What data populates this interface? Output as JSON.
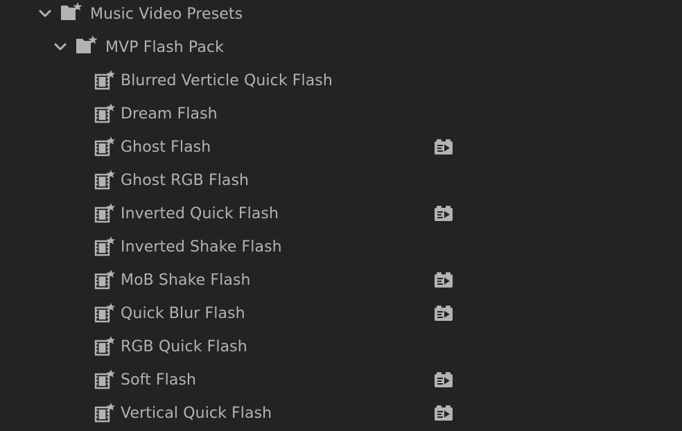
{
  "tree": {
    "root": {
      "label": "Music Video Presets",
      "expanded": true,
      "icon": "preset-bin-icon"
    },
    "group": {
      "label": "MVP Flash Pack",
      "expanded": true,
      "icon": "preset-bin-icon"
    },
    "presets": [
      {
        "label": "Blurred Verticle Quick Flash",
        "icon": "preset-clip-icon",
        "badge": false
      },
      {
        "label": "Dream Flash",
        "icon": "preset-clip-icon",
        "badge": false
      },
      {
        "label": "Ghost Flash",
        "icon": "preset-clip-icon",
        "badge": true
      },
      {
        "label": "Ghost RGB Flash",
        "icon": "preset-clip-icon",
        "badge": false
      },
      {
        "label": "Inverted Quick Flash",
        "icon": "preset-clip-icon",
        "badge": true
      },
      {
        "label": "Inverted Shake Flash",
        "icon": "preset-clip-icon",
        "badge": false
      },
      {
        "label": "MoB Shake Flash",
        "icon": "preset-clip-icon",
        "badge": true
      },
      {
        "label": "Quick Blur Flash",
        "icon": "preset-clip-icon",
        "badge": true
      },
      {
        "label": "RGB Quick Flash",
        "icon": "preset-clip-icon",
        "badge": false
      },
      {
        "label": "Soft Flash",
        "icon": "preset-clip-icon",
        "badge": true
      },
      {
        "label": "Vertical Quick Flash",
        "icon": "preset-clip-icon",
        "badge": true
      }
    ],
    "badge_icon": "transition-preset-icon"
  },
  "colors": {
    "background": "#232323",
    "text": "#b3b3b3",
    "icon": "#b3b3b3"
  }
}
